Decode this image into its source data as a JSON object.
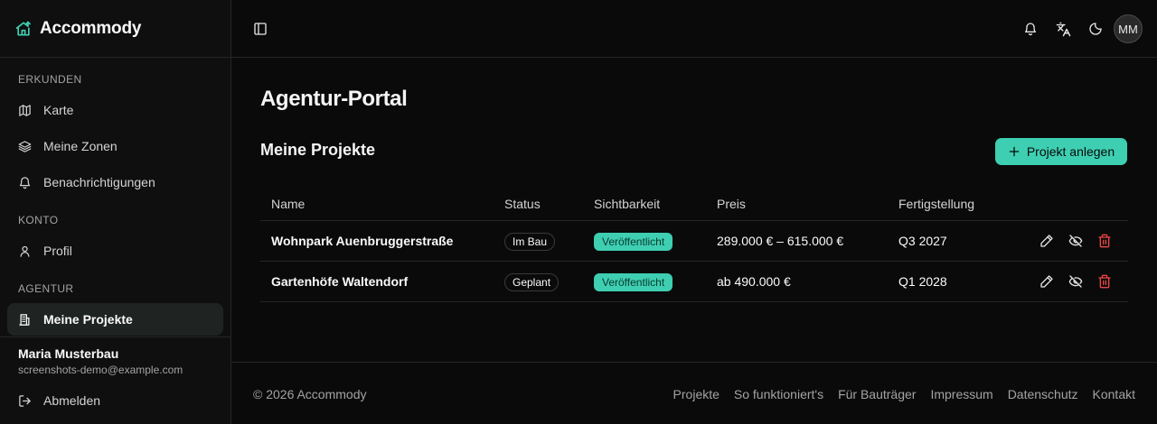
{
  "brand": {
    "name": "Accommody",
    "accent": "#3ecfb2"
  },
  "sidebar": {
    "sections": [
      {
        "label": "ERKUNDEN",
        "items": [
          {
            "label": "Karte",
            "icon": "map-icon"
          },
          {
            "label": "Meine Zonen",
            "icon": "layers-icon"
          },
          {
            "label": "Benachrichtigungen",
            "icon": "bell-icon"
          }
        ]
      },
      {
        "label": "KONTO",
        "items": [
          {
            "label": "Profil",
            "icon": "user-icon"
          }
        ]
      },
      {
        "label": "AGENTUR",
        "items": [
          {
            "label": "Meine Projekte",
            "icon": "building-icon",
            "active": true
          }
        ]
      }
    ],
    "user": {
      "name": "Maria Musterbau",
      "email": "screenshots-demo@example.com"
    },
    "logout_label": "Abmelden"
  },
  "topbar": {
    "avatar_initials": "MM",
    "icons": [
      "sidebar-toggle-icon",
      "bell-icon",
      "translate-icon",
      "moon-icon"
    ]
  },
  "main": {
    "page_title": "Agentur-Portal",
    "section_title": "Meine Projekte",
    "create_button_label": "Projekt anlegen",
    "table": {
      "headers": [
        "Name",
        "Status",
        "Sichtbarkeit",
        "Preis",
        "Fertigstellung"
      ],
      "rows": [
        {
          "name": "Wohnpark Auenbruggerstraße",
          "status": "Im Bau",
          "visibility": "Veröffentlicht",
          "price": "289.000 € – 615.000 €",
          "completion": "Q3 2027"
        },
        {
          "name": "Gartenhöfe Waltendorf",
          "status": "Geplant",
          "visibility": "Veröffentlicht",
          "price": "ab 490.000 €",
          "completion": "Q1 2028"
        }
      ]
    }
  },
  "footer": {
    "copyright": "© 2026 Accommody",
    "links": [
      "Projekte",
      "So funktioniert's",
      "Für Bauträger",
      "Impressum",
      "Datenschutz",
      "Kontakt"
    ]
  },
  "colors": {
    "delete": "#ef4444",
    "badge_bg": "#3ecfb2"
  }
}
